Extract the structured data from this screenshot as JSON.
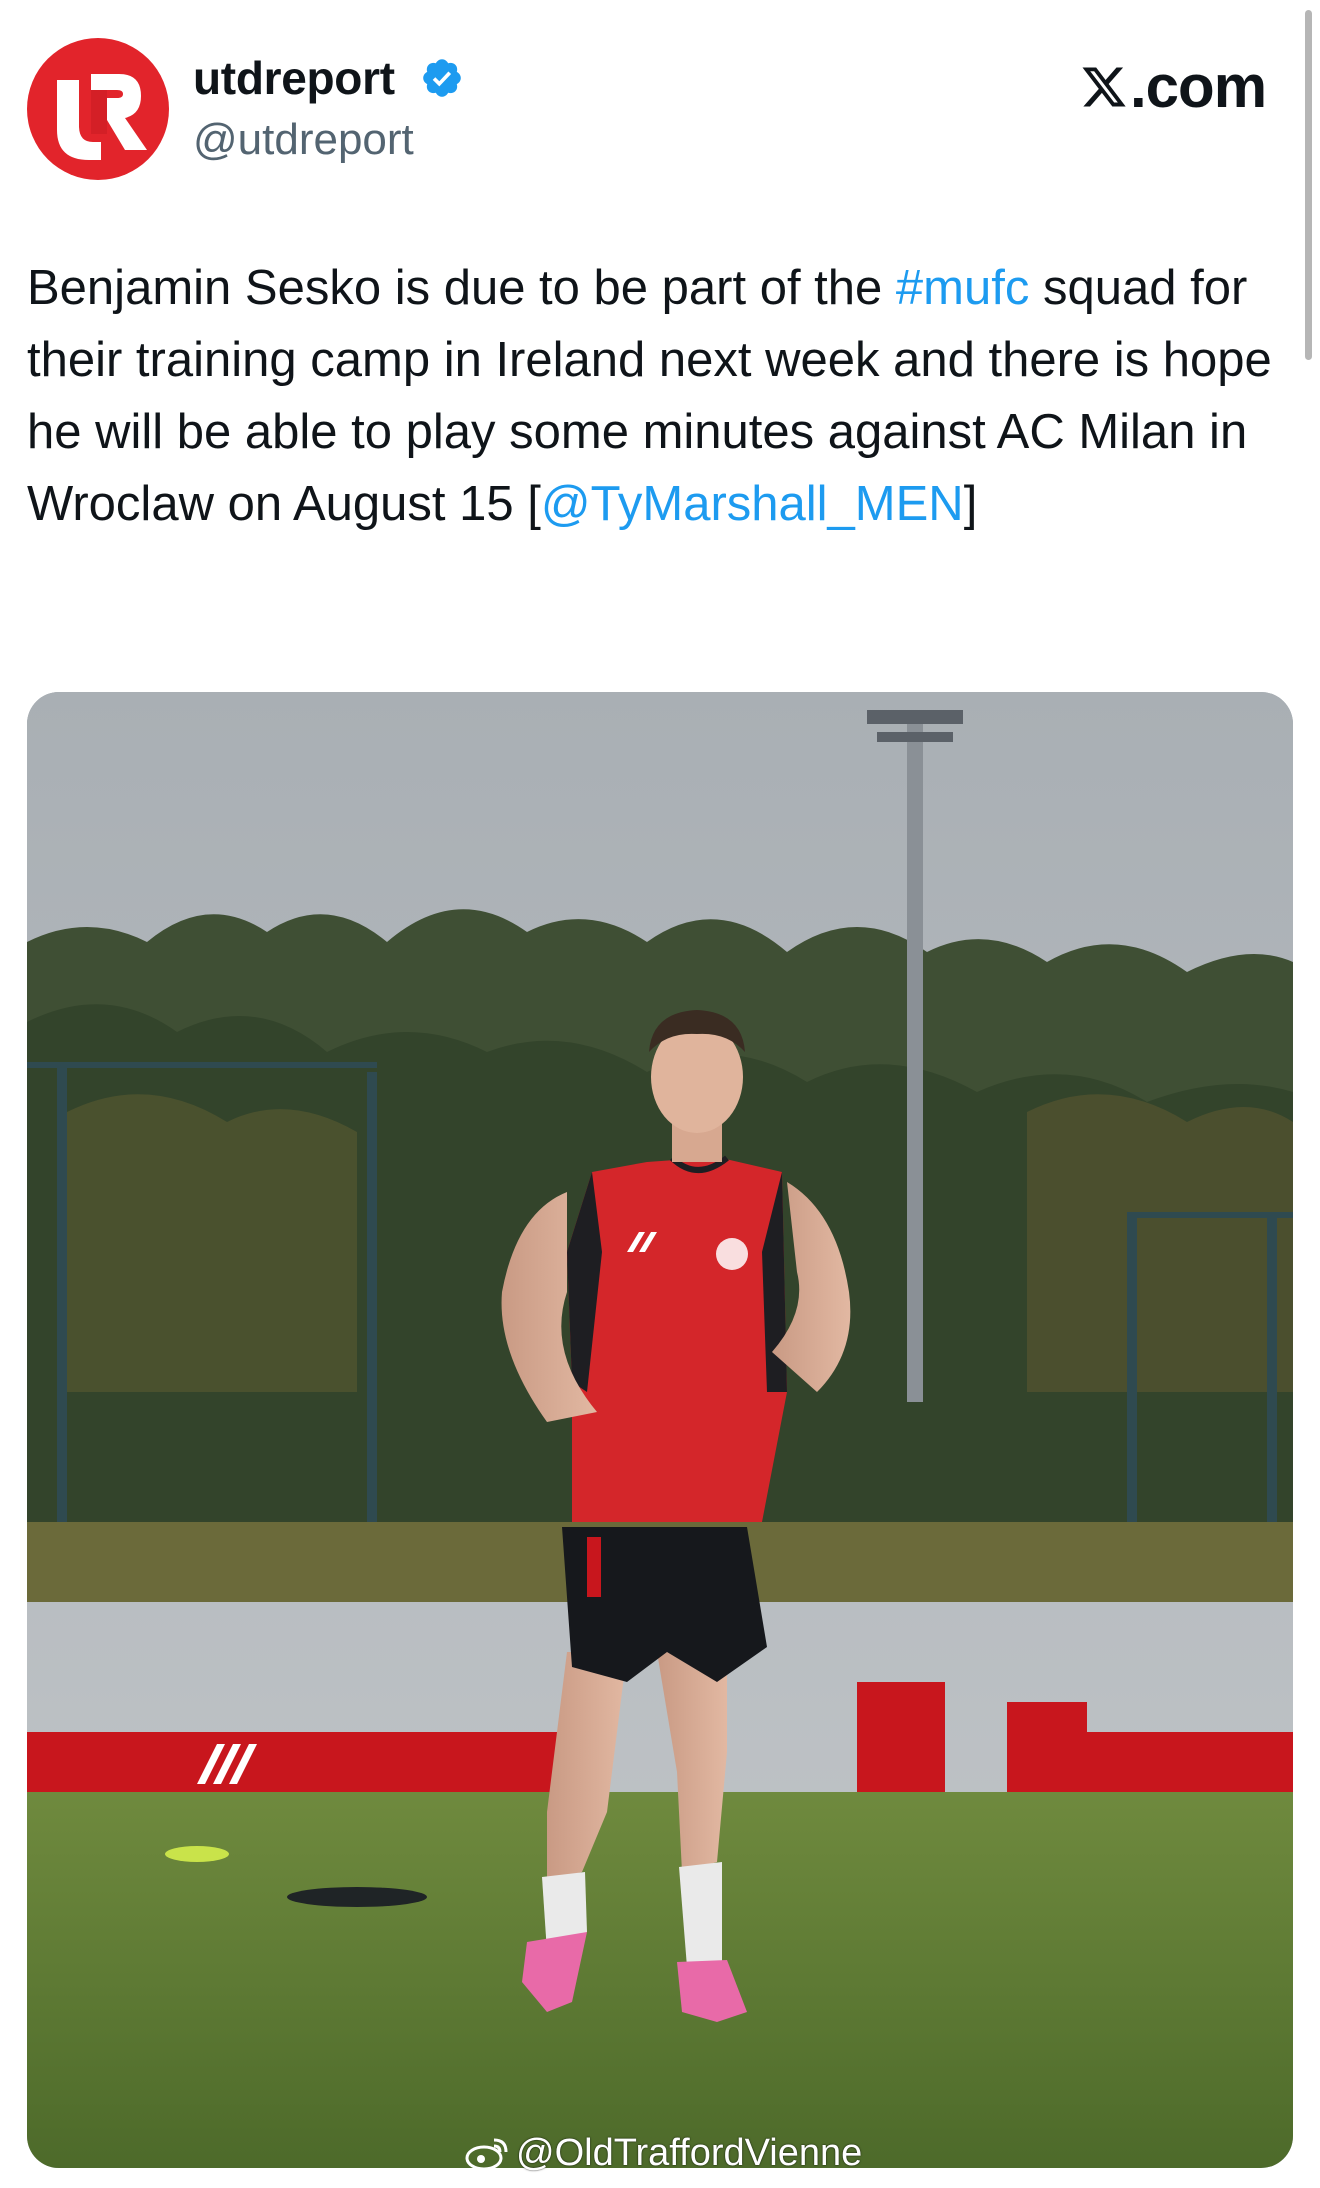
{
  "author": {
    "display_name": "utdreport",
    "handle": "@utdreport",
    "verified": true,
    "avatar_icon": "utdreport-logo-icon",
    "avatar_color": "#e2242b"
  },
  "site": {
    "label": ".com",
    "icon": "x-logo-icon"
  },
  "tweet": {
    "line1_text": "Benjamin Sesko is due to be part of the ",
    "hashtag": "#mufc",
    "line2_text": "squad for their training camp in Ireland next week and there is hope he will be able to play some minutes against AC Milan in Wroclaw on August 15",
    "mention_open": "[",
    "mention": "@TyMarshall_MEN",
    "mention_close": "]",
    "link_color": "#1d9bf0"
  },
  "watermark": {
    "text": "@OldTraffordVienne",
    "icon": "weibo-icon"
  }
}
